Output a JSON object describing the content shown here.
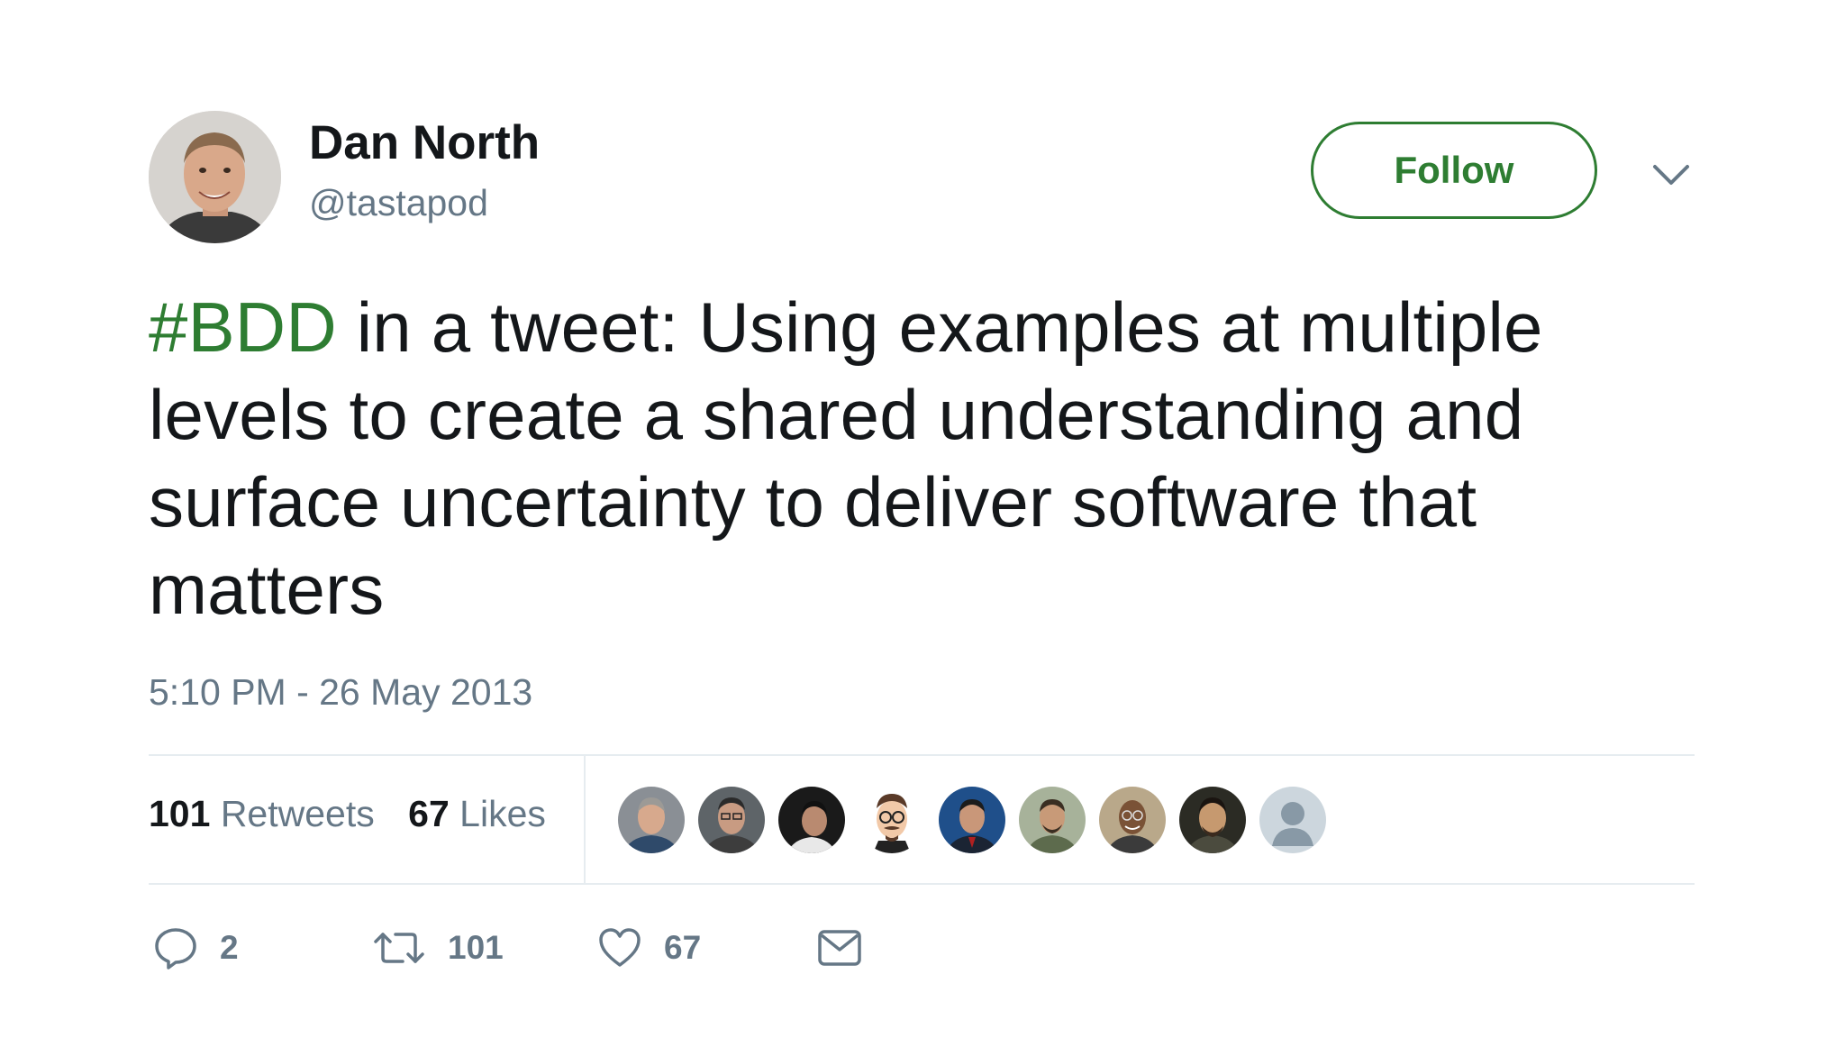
{
  "author": {
    "display_name": "Dan North",
    "handle": "@tastapod",
    "avatar_icon": "user-photo"
  },
  "follow_button": {
    "label": "Follow",
    "color": "#2e7d32"
  },
  "menu_icon": "chevron-down-icon",
  "tweet": {
    "hashtag": "#BDD",
    "text": " in a tweet: Using examples at multiple levels to create a shared understanding and surface uncertainty to deliver software that matters",
    "timestamp": "5:10 PM - 26 May 2013"
  },
  "stats": {
    "retweets_count": "101",
    "retweets_label": "Retweets",
    "likes_count": "67",
    "likes_label": "Likes"
  },
  "likers": [
    {
      "icon": "user-photo"
    },
    {
      "icon": "user-photo"
    },
    {
      "icon": "user-photo"
    },
    {
      "icon": "cartoon-avatar"
    },
    {
      "icon": "user-photo"
    },
    {
      "icon": "user-photo"
    },
    {
      "icon": "user-photo"
    },
    {
      "icon": "user-photo"
    },
    {
      "icon": "default-avatar"
    }
  ],
  "actions": {
    "reply_count": "2",
    "retweet_count": "101",
    "like_count": "67"
  },
  "colors": {
    "accent": "#2e7d32",
    "secondary_text": "#657786",
    "primary_text": "#14171a"
  }
}
